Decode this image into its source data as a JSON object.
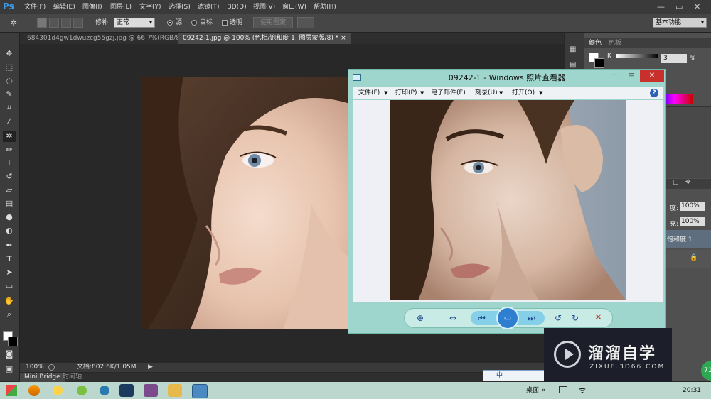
{
  "app": {
    "logo": "Ps"
  },
  "menubar": {
    "items": [
      "文件(F)",
      "编辑(E)",
      "图像(I)",
      "图层(L)",
      "文字(Y)",
      "选择(S)",
      "滤镜(T)",
      "3D(D)",
      "视图(V)",
      "窗口(W)",
      "帮助(H)"
    ],
    "minimize": "—",
    "restore": "▭",
    "close": "✕"
  },
  "options": {
    "tool_label": "修补:",
    "mode_value": "正常",
    "source_label": "源",
    "target_label": "目标",
    "transparent_label": "透明",
    "use_pattern_label": "使用图案",
    "workspace_value": "基本功能"
  },
  "tabs": [
    {
      "label": "684301d4gw1dwuzcg55gzj.jpg @ 66.7%(RGB/8#)",
      "close": "×"
    },
    {
      "label": "09242-1.jpg @ 100% (色相/饱和度 1, 图层蒙版/8) *",
      "close": "×"
    }
  ],
  "status": {
    "zoom": "100%",
    "doc": "文档:802.6K/1.05M"
  },
  "bridge": {
    "tab1": "Mini Bridge",
    "tab2": "时间轴"
  },
  "right_panel": {
    "tab_color": "颜色",
    "tab_swatches": "色板",
    "k_label": "K",
    "k_value": "3",
    "k_unit": "%",
    "opacity_label": "度:",
    "opacity_value": "100%",
    "fill_label": "充:",
    "fill_value": "100%",
    "layer_name": "饱和度 1"
  },
  "viewer": {
    "title": "09242-1 - Windows 照片查看器",
    "menu": [
      "文件(F)",
      "打印(P)",
      "电子邮件(E)",
      "刻录(U)",
      "打开(O)"
    ],
    "help": "?",
    "minimize": "—",
    "maximize": "▭",
    "close": "✕"
  },
  "taskbar": {
    "desktop_label": "桌面",
    "time": "20:31",
    "ime_label": "中"
  },
  "watermark": {
    "brand": "溜溜自学",
    "url": "ZIXUE.3D66.COM"
  },
  "badge": {
    "value": "71"
  },
  "colors": {
    "accent": "#3d9be9",
    "viewer_frame": "#9ed5cc",
    "close_red": "#c9302c",
    "taskbar": "#bcd8ce"
  }
}
